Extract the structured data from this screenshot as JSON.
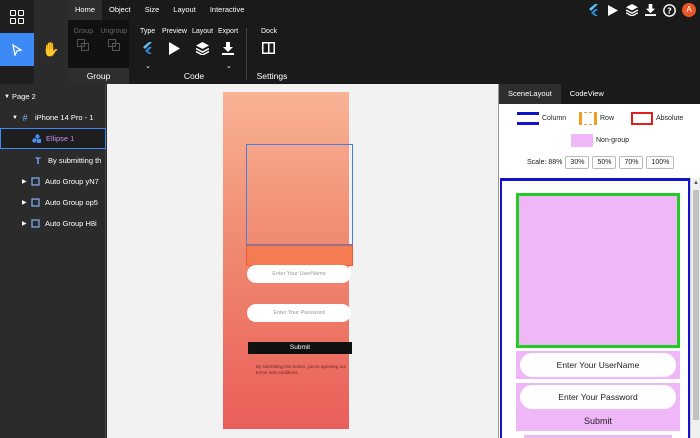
{
  "toolbar": {
    "tabs": [
      {
        "label": "Home",
        "active": true
      },
      {
        "label": "Object"
      },
      {
        "label": "Size"
      },
      {
        "label": "Layout"
      },
      {
        "label": "Interactive"
      }
    ],
    "group_label": "Group",
    "ungroup_label": "Ungroup",
    "group_section_label": "Group",
    "type_label": "Type",
    "preview_label": "Preview",
    "layout_label": "Layout",
    "export_label": "Export",
    "code_section_label": "Code",
    "dock_label": "Dock",
    "settings_section_label": "Settings",
    "avatar_letter": "A",
    "icons": [
      "apps-icon",
      "pointer-icon",
      "hand-icon",
      "flutter-icon",
      "play-icon",
      "layers-icon",
      "download-icon",
      "help-icon"
    ]
  },
  "layers": {
    "page_label": "Page 2",
    "items": [
      {
        "label": "iPhone 14 Pro - 1",
        "icon": "frame-icon"
      },
      {
        "label": "Ellipse 1",
        "icon": "shapes-icon",
        "selected": true
      },
      {
        "label": "By submitting th",
        "icon": "text-icon"
      },
      {
        "label": "Auto Group yN7",
        "icon": "autogroup-icon"
      },
      {
        "label": "Auto Group op5",
        "icon": "autogroup-icon"
      },
      {
        "label": "Auto Group H8i",
        "icon": "autogroup-icon"
      }
    ]
  },
  "artboard": {
    "username_placeholder": "Enter Your UserName",
    "password_placeholder": "Enter Your Password",
    "submit_label": "Submit",
    "terms_text": "By submitting this button, you're agreeing our terms and conditions."
  },
  "right_panel": {
    "tabs": [
      {
        "label": "SceneLayout",
        "active": true
      },
      {
        "label": "CodeView"
      }
    ],
    "legend": {
      "column": "Column",
      "row": "Row",
      "absolute": "Absolute",
      "non_group": "Non-group"
    },
    "scale_label": "Scale: 88%",
    "scale_options": [
      "30%",
      "50%",
      "70%",
      "100%"
    ],
    "preview": {
      "username": "Enter Your UserName",
      "password": "Enter Your Password",
      "submit": "Submit"
    }
  },
  "colors": {
    "accent": "#3d8af7",
    "column": "#1212c8",
    "row": "#f0a020",
    "absolute": "#e02020",
    "non_group": "#efb7f7",
    "highlight": "#22cc22"
  }
}
